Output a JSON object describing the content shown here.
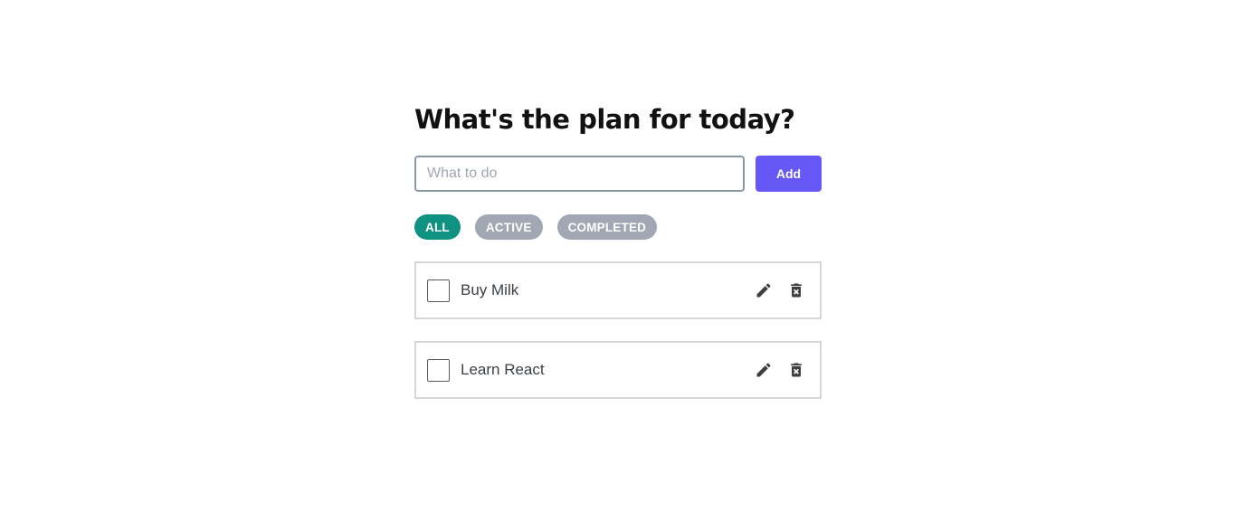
{
  "header": {
    "title": "What's the plan for today?"
  },
  "add_form": {
    "placeholder": "What to do",
    "value": "",
    "button_label": "Add"
  },
  "filters": [
    {
      "label": "ALL",
      "active": true
    },
    {
      "label": "ACTIVE",
      "active": false
    },
    {
      "label": "COMPLETED",
      "active": false
    }
  ],
  "todos": [
    {
      "text": "Buy Milk",
      "completed": false
    },
    {
      "text": "Learn React",
      "completed": false
    }
  ],
  "colors": {
    "accent": "#6657f7",
    "filter_active": "#109283",
    "filter_inactive": "#a1a8b3"
  },
  "icons": {
    "edit": "pencil-icon",
    "delete": "trash-x-icon"
  }
}
